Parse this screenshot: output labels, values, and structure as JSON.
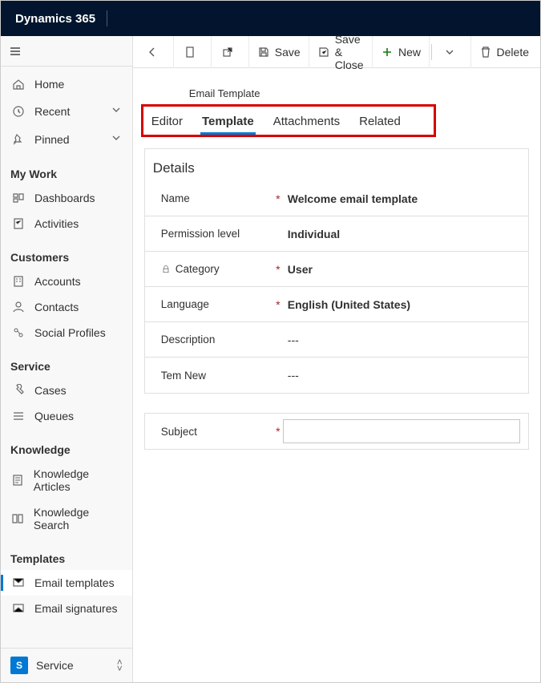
{
  "topbar": {
    "title": "Dynamics 365"
  },
  "cmdbar": {
    "save": "Save",
    "save_close": "Save & Close",
    "new": "New",
    "delete": "Delete"
  },
  "sidebar": {
    "top": [
      {
        "label": "Home"
      },
      {
        "label": "Recent"
      },
      {
        "label": "Pinned"
      }
    ],
    "groups": [
      {
        "title": "My Work",
        "items": [
          {
            "label": "Dashboards"
          },
          {
            "label": "Activities"
          }
        ]
      },
      {
        "title": "Customers",
        "items": [
          {
            "label": "Accounts"
          },
          {
            "label": "Contacts"
          },
          {
            "label": "Social Profiles"
          }
        ]
      },
      {
        "title": "Service",
        "items": [
          {
            "label": "Cases"
          },
          {
            "label": "Queues"
          }
        ]
      },
      {
        "title": "Knowledge",
        "items": [
          {
            "label": "Knowledge Articles"
          },
          {
            "label": "Knowledge Search"
          }
        ]
      },
      {
        "title": "Templates",
        "items": [
          {
            "label": "Email templates",
            "active": true
          },
          {
            "label": "Email signatures"
          }
        ]
      }
    ],
    "footer": {
      "tile": "S",
      "label": "Service"
    }
  },
  "record": {
    "entity_label": "Email Template",
    "tabs": [
      {
        "label": "Editor"
      },
      {
        "label": "Template",
        "active": true
      },
      {
        "label": "Attachments"
      },
      {
        "label": "Related"
      }
    ],
    "details_title": "Details",
    "fields": {
      "name_label": "Name",
      "name_value": "Welcome email template",
      "perm_label": "Permission level",
      "perm_value": "Individual",
      "cat_label": "Category",
      "cat_value": "User",
      "lang_label": "Language",
      "lang_value": "English (United States)",
      "desc_label": "Description",
      "desc_value": "---",
      "temnew_label": "Tem New",
      "temnew_value": "---",
      "subject_label": "Subject",
      "subject_value": ""
    }
  }
}
